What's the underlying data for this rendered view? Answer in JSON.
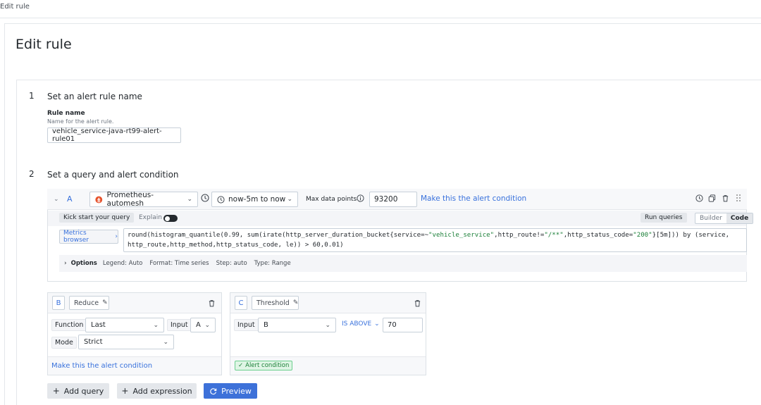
{
  "breadcrumb": "Edit rule",
  "page_title": "Edit rule",
  "step1": {
    "number": "1",
    "title": "Set an alert rule name",
    "rule_name_label": "Rule name",
    "rule_name_desc": "Name for the alert rule.",
    "rule_name_value": "vehicle_service-java-rt99-alert-rule01"
  },
  "step2": {
    "number": "2",
    "title": "Set a query and alert condition"
  },
  "query": {
    "letter": "A",
    "datasource": "Prometheus-automesh",
    "time_range": "now-5m to now",
    "max_dp_label": "Max data points",
    "max_dp_value": "93200",
    "alert_condition_link": "Make this the alert condition",
    "kick_start": "Kick start your query",
    "explain": "Explain",
    "run_queries": "Run queries",
    "mode_builder": "Builder",
    "mode_code": "Code",
    "metrics_browser": "Metrics browser",
    "code_line1_a": "round(histogram_quantile(0.99, sum(irate(http_server_duration_bucket{service=~",
    "code_line1_str1": "\"vehicle_service\"",
    "code_line1_b": ",http_route!=",
    "code_line1_str2": "\"/**\"",
    "code_line1_c": ",http_status_code=",
    "code_line1_str3": "\"200\"",
    "code_line1_d": "}[5m])) by (service,",
    "code_line2": "http_route,http_method,http_status_code, le)) > 60,0.01)",
    "options_label": "Options",
    "opt_legend": "Legend: Auto",
    "opt_format": "Format: Time series",
    "opt_step": "Step: auto",
    "opt_type": "Type: Range"
  },
  "expr_b": {
    "letter": "B",
    "type": "Reduce",
    "function_label": "Function",
    "function_value": "Last",
    "input_label": "Input",
    "input_value": "A",
    "mode_label": "Mode",
    "mode_value": "Strict",
    "footer_link": "Make this the alert condition"
  },
  "expr_c": {
    "letter": "C",
    "type": "Threshold",
    "input_label": "Input",
    "input_value": "B",
    "op_value": "IS ABOVE",
    "threshold_value": "70",
    "footer_tag": "Alert condition"
  },
  "buttons": {
    "add_query": "Add query",
    "add_expression": "Add expression",
    "preview": "Preview"
  },
  "colors": {
    "accent": "#3d71d9",
    "link": "#3871dc",
    "prometheus": "#e6522c",
    "success": "#1a7f37"
  }
}
